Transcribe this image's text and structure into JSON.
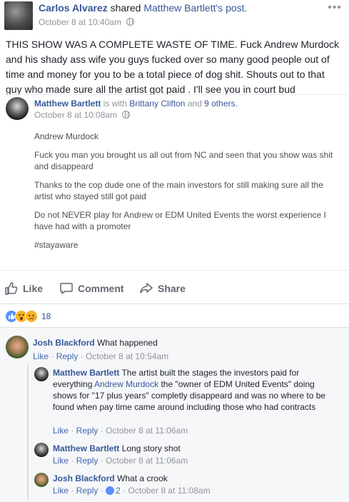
{
  "post": {
    "author": "Carlos Alvarez",
    "shared_text": "shared",
    "original_author": "Matthew Bartlett",
    "original_suffix": "'s post.",
    "timestamp": "October 8 at 10:40am",
    "menu_icon": "three-dots-icon",
    "body": "THIS SHOW WAS A COMPLETE WASTE OF TIME. Fuck Andrew Murdock and his shady ass wife you guys fucked over so many good people out of time and money for you to be a total piece of dog shit. Shouts out to that guy who made sure all the artist got paid . I'll see you in court bud"
  },
  "shared_post": {
    "author": "Matthew Bartlett",
    "is_with": "is with",
    "tagged": "Brittany Clifton",
    "and": "and",
    "others": "9 others.",
    "timestamp": "October 8 at 10:08am",
    "paragraphs": [
      "Andrew Murdock",
      "Fuck you man you brought us all out from NC and seen that you show was shit and disappeard",
      "Thanks to the cop dude one of the main investors for still making sure all the artist who stayed still got paid",
      "Do not NEVER play for Andrew or EDM United Events the worst experience I have had with a promoter",
      "#stayaware"
    ]
  },
  "actions": {
    "like": "Like",
    "comment": "Comment",
    "share": "Share"
  },
  "reactions": {
    "count": "18",
    "types": [
      "like-icon",
      "wow-icon",
      "sad-icon"
    ]
  },
  "comments": [
    {
      "author": "Josh Blackford",
      "text": "What happened",
      "like": "Like",
      "reply": "Reply",
      "time": "October 8 at 10:54am"
    },
    {
      "author": "Matthew Bartlett",
      "text_before": "The artist built the stages the investors paid for everything",
      "mention": "Andrew Murdock",
      "text_after": "the \"owner of EDM United Events\" doing shows for \"17 plus years\" completly disappeard and was no where to be found when pay time came around including those who had contracts",
      "like": "Like",
      "reply": "Reply",
      "time": "October 8 at 11:06am"
    },
    {
      "author": "Matthew Bartlett",
      "text": "Long story shot",
      "like": "Like",
      "reply": "Reply",
      "time": "October 8 at 11:06am"
    },
    {
      "author": "Josh Blackford",
      "text": "What a crook",
      "like": "Like",
      "reply": "Reply",
      "likes": "2",
      "time": "October 8 at 11:08am"
    }
  ],
  "colors": {
    "link": "#365899",
    "meta": "#90949c",
    "comments_bg": "#f6f7f9",
    "like_blue": "#5890ff"
  }
}
